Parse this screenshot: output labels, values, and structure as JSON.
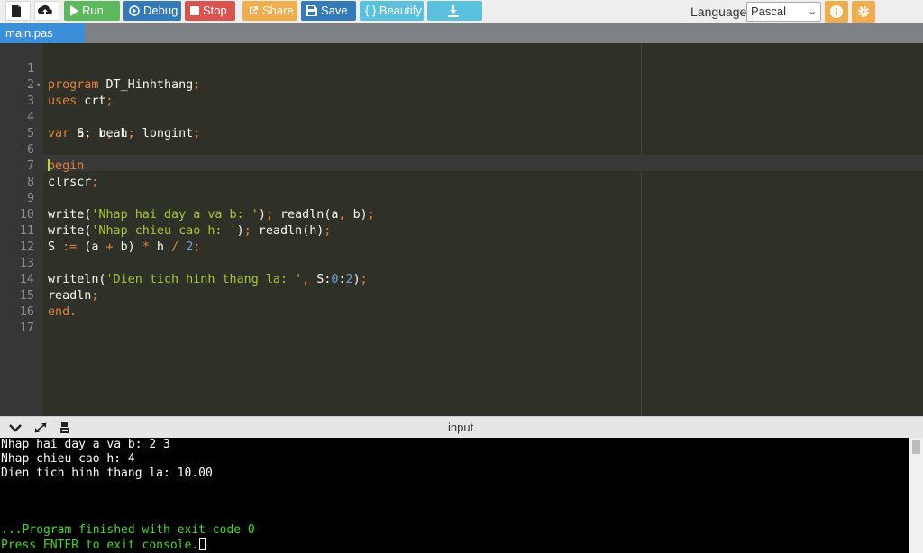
{
  "toolbar": {
    "run_label": "Run",
    "debug_label": "Debug",
    "stop_label": "Stop",
    "share_label": "Share",
    "save_label": "Save",
    "beautify_label": "{ } Beautify",
    "language_label": "Language",
    "language_value": "Pascal"
  },
  "tabs": [
    {
      "label": "main.pas"
    }
  ],
  "editor": {
    "line_numbers": [
      "1",
      "2",
      "3",
      "4",
      "5",
      "6",
      "7",
      "8",
      "9",
      "10",
      "11",
      "12",
      "13",
      "14",
      "15",
      "16",
      "17"
    ],
    "active_line": 8
  },
  "console": {
    "title": "input",
    "lines": [
      "Nhap hai day a va b: 2 3",
      "Nhap chieu cao h: 4",
      "Dien tich hinh thang la: 10.00"
    ],
    "finished": "...Program finished with exit code 0",
    "exit_prompt": "Press ENTER to exit console."
  },
  "colors": {
    "run": "#5cb85c",
    "debug": "#337ab7",
    "stop": "#d9534f",
    "share": "#f0ad4e",
    "beautify": "#5bc0de",
    "tab_active": "#3a8fd8",
    "editor_bg": "#2f3129",
    "keyword": "#e0813d",
    "string": "#a6c53b",
    "number": "#6fa1d8",
    "console_green": "#4cd232"
  },
  "icons": [
    "new-file-icon",
    "upload-icon",
    "play-icon",
    "debug-icon",
    "stop-icon",
    "share-icon",
    "save-icon",
    "download-icon",
    "info-icon",
    "gear-icon",
    "chevron-down-icon",
    "expand-icon",
    "stdin-icon"
  ]
}
